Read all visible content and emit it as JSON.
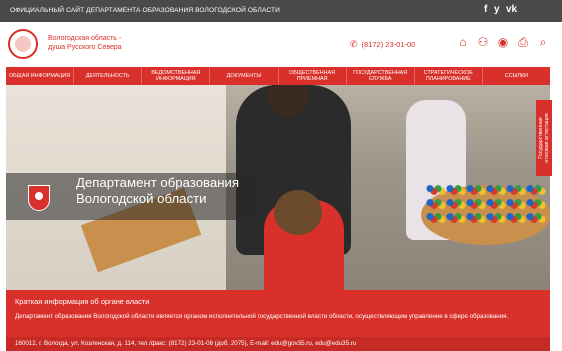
{
  "topbar": {
    "title": "ОФИЦИАЛЬНЫЙ САЙТ ДЕПАРТАМЕНТА ОБРАЗОВАНИЯ ВОЛОГОДСКОЙ ОБЛАСТИ",
    "social": [
      "f",
      "y",
      "vk"
    ]
  },
  "header": {
    "brand_line1": "Вологодская область -",
    "brand_line2": "душа Русского Севера",
    "phone": "(8172) 23-01-00",
    "icons": [
      "home-icon",
      "sitemap-icon",
      "eye-icon",
      "print-icon",
      "search-icon"
    ]
  },
  "nav": {
    "items": [
      "ОБЩАЯ ИНФОРМАЦИЯ",
      "ДЕЯТЕЛЬНОСТЬ",
      "ВЕДОМСТВЕННАЯ ИНФОРМАЦИЯ",
      "ДОКУМЕНТЫ",
      "ОБЩЕСТВЕННАЯ ПРИЕМНАЯ",
      "ГОСУДАРСТВЕННАЯ СЛУЖБА",
      "СТРАТЕГИЧЕСКОЕ ПЛАНИРОВАНИЕ",
      "ССЫЛКИ"
    ]
  },
  "hero": {
    "title_line1": "Департамент образования",
    "title_line2": "Вологодской области"
  },
  "side_tab": {
    "line1": "Государственная",
    "line2": "итоговая аттестация"
  },
  "info": {
    "heading": "Краткая информация об органе власти",
    "description": "Департамент образования Вологодской области является органом исполнительной государственной власти области, осуществляющим управление в сфере образования."
  },
  "footer": {
    "address": "160012, г. Вологда, ул. Козленская, д. 114, тел./факс: (8172) 23-01-06 (доб. 2075), E-mail: edu@gov35.ru, edu@edu35.ru"
  },
  "colors": {
    "accent": "#d9302b",
    "topbar": "#4a4a4a"
  }
}
